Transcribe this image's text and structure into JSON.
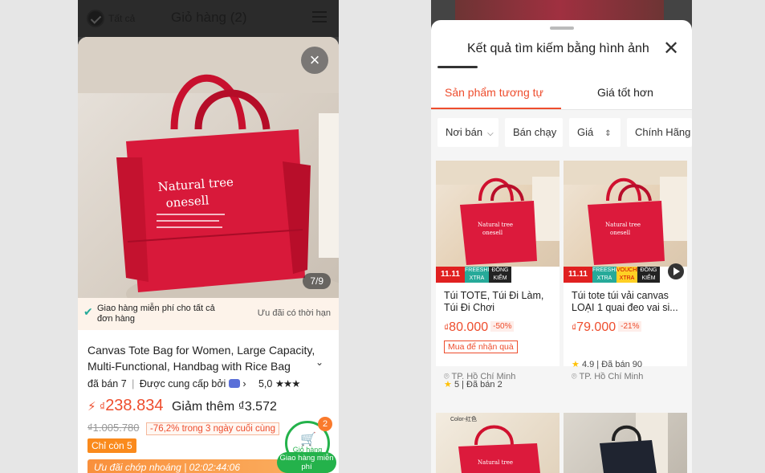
{
  "left": {
    "header": {
      "select_all": "Tất cả",
      "title": "Giỏ hàng (2)"
    },
    "photo": {
      "counter": "7/9",
      "close": "×",
      "bag_text": [
        "Natural tree",
        "onesell"
      ]
    },
    "free_ship_banner": {
      "text": "Giao hàng miễn phí cho tất cả đơn hàng",
      "limited": "Ưu đãi có thời hạn"
    },
    "product": {
      "title": "Canvas Tote Bag for Women, Large Capacity, Multi-Functional, Handbag with Rice Bag",
      "sold": "đã bán 7",
      "provided_by": "Được cung cấp bởi",
      "rating": "5,0",
      "price_currency": "₫",
      "price": "238.834",
      "extra_discount": "Giảm thêm ₫3.572",
      "old_price": "₫1.005.780",
      "discount_note": "-76,2% trong 3 ngày cuối cùng",
      "only_left": "Chỉ còn 5",
      "deal_bar": "Ưu đãi chớp nhoáng | 02:02:44:06"
    },
    "cart_fab": {
      "label": "Giỏ hàng",
      "count": "2",
      "free_ship": "Giao hàng miễn phí"
    }
  },
  "right": {
    "sheet": {
      "title": "Kết quả tìm kiếm bằng hình ảnh"
    },
    "tabs": [
      {
        "label": "Sản phẩm tương tự"
      },
      {
        "label": "Giá tốt hơn"
      }
    ],
    "filters": [
      {
        "label": "Nơi bán"
      },
      {
        "label": "Bán chạy"
      },
      {
        "label": "Giá"
      },
      {
        "label": "Chính Hãng"
      }
    ],
    "results": [
      {
        "name": "Túi TOTE, Túi Đi Làm, Túi Đi Chơi",
        "price_currency": "₫",
        "price": "80.000",
        "discount": "-50%",
        "gift": "Mua để nhận quà",
        "rating": "5",
        "sold": "Đã bán 2",
        "location": "TP. Hồ Chí Minh"
      },
      {
        "name": "Túi tote túi vải canvas LOẠI 1 quai đeo vai si...",
        "price_currency": "₫",
        "price": "79.000",
        "discount": "-21%",
        "rating": "4.9",
        "sold": "Đã bán 90",
        "location": "TP. Hồ Chí Minh"
      }
    ],
    "promo_badge": {
      "sale": "11.11",
      "ship": "FREESHIP XTRA",
      "voucher": "VOUCHER XTRA",
      "official": "ĐỒNG KIỂM"
    },
    "second_row_label": "Color-红色"
  },
  "colors": {
    "accent": "#ee4d2d",
    "bag_red": "#d8193a",
    "cart_green": "#24b24b",
    "orange": "#fa8a1c"
  }
}
